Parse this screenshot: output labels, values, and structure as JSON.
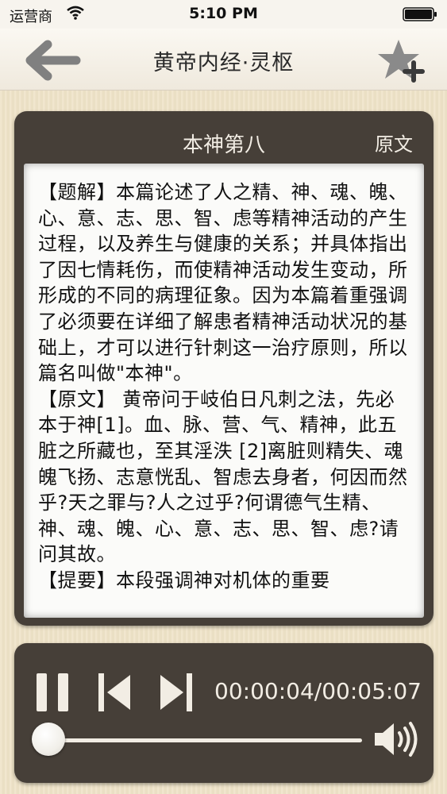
{
  "status_bar": {
    "carrier": "运营商",
    "time": "5:10 PM"
  },
  "nav": {
    "title": "黄帝内经·灵枢",
    "back_icon": "arrow-left-icon",
    "favorite_icon": "star-plus-icon"
  },
  "reader": {
    "chapter_title": "本神第八",
    "original_button": "原文",
    "paragraphs": [
      "【题解】本篇论述了人之精、神、魂、魄、心、意、志、思、智、虑等精神活动的产生过程，以及养生与健康的关系；并具体指出了因七情耗伤，而使精神活动发生变动，所形成的不同的病理征象。因为本篇着重强调了必须要在详细了解患者精神活动状况的基础上，才可以进行针刺这一治疗原则，所以篇名叫做\"本神\"。",
      "【原文】 黄帝问于岐伯日凡刺之法，先必本于神[1]。血、脉、营、气、精神，此五脏之所藏也，至其淫泆 [2]离脏则精失、魂魄飞扬、志意恍乱、智虑去身者，何因而然乎?天之罪与?人之过乎?何谓德气生精、神、魂、魄、心、意、志、思、智、虑?请问其故。",
      "【提要】本段强调神对机体的重要"
    ]
  },
  "player": {
    "time_readout": "00:00:04/00:05:07",
    "progress_fraction": 0.013,
    "icons": [
      "pause-icon",
      "previous-track-icon",
      "next-track-icon",
      "volume-icon"
    ]
  }
}
